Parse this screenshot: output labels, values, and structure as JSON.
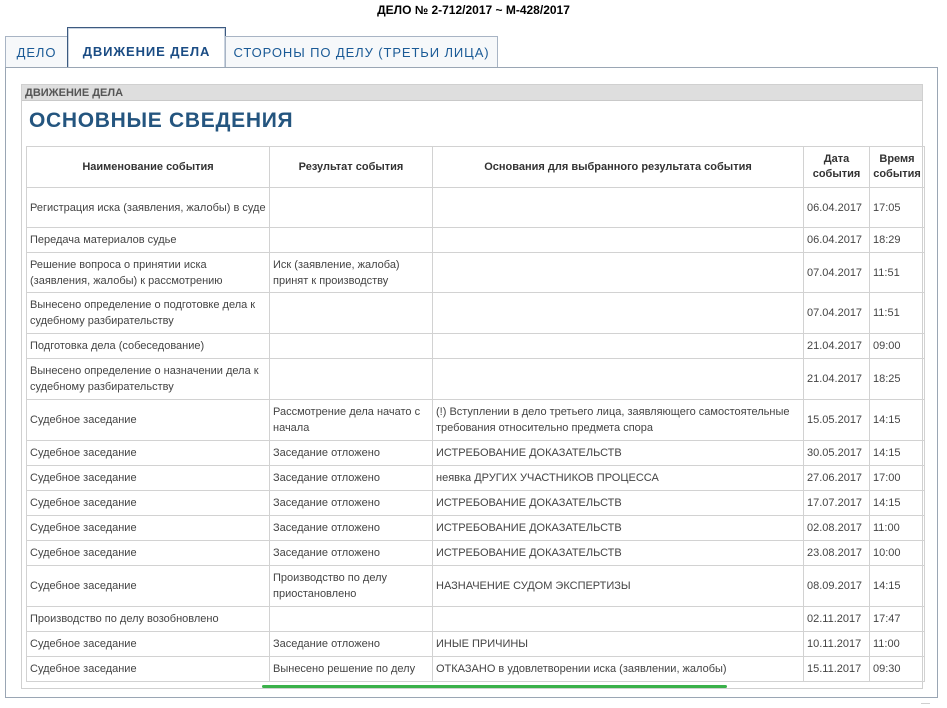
{
  "case_title": "ДЕЛО № 2-712/2017 ~ М-428/2017",
  "tabs": [
    {
      "label": "ДЕЛО"
    },
    {
      "label": "ДВИЖЕНИЕ ДЕЛА"
    },
    {
      "label": "СТОРОНЫ ПО ДЕЛУ (ТРЕТЬИ ЛИЦА)"
    }
  ],
  "section_label": "ДВИЖЕНИЕ ДЕЛА",
  "heading": "ОСНОВНЫЕ СВЕДЕНИЯ",
  "table": {
    "headers": [
      "Наименование события",
      "Результат события",
      "Основания для выбранного результата события",
      "Дата события",
      "Время события"
    ],
    "rows": [
      [
        "Регистрация иска (заявления, жалобы) в суде",
        "",
        "",
        "06.04.2017",
        "17:05"
      ],
      [
        "Передача материалов судье",
        "",
        "",
        "06.04.2017",
        "18:29"
      ],
      [
        "Решение вопроса о принятии иска (заявления, жалобы) к рассмотрению",
        "Иск (заявление, жалоба) принят к производству",
        "",
        "07.04.2017",
        "11:51"
      ],
      [
        "Вынесено определение о подготовке дела к судебному разбирательству",
        "",
        "",
        "07.04.2017",
        "11:51"
      ],
      [
        "Подготовка дела (собеседование)",
        "",
        "",
        "21.04.2017",
        "09:00"
      ],
      [
        "Вынесено определение о назначении дела к судебному разбирательству",
        "",
        "",
        "21.04.2017",
        "18:25"
      ],
      [
        "Судебное заседание",
        "Рассмотрение дела начато с начала",
        "(!) Вступлении в дело третьего лица, заявляющего самостоятельные требования относительно предмета спора",
        "15.05.2017",
        "14:15"
      ],
      [
        "Судебное заседание",
        "Заседание отложено",
        "ИСТРЕБОВАНИЕ ДОКАЗАТЕЛЬСТВ",
        "30.05.2017",
        "14:15"
      ],
      [
        "Судебное заседание",
        "Заседание отложено",
        "неявка ДРУГИХ УЧАСТНИКОВ ПРОЦЕССА",
        "27.06.2017",
        "17:00"
      ],
      [
        "Судебное заседание",
        "Заседание отложено",
        "ИСТРЕБОВАНИЕ ДОКАЗАТЕЛЬСТВ",
        "17.07.2017",
        "14:15"
      ],
      [
        "Судебное заседание",
        "Заседание отложено",
        "ИСТРЕБОВАНИЕ ДОКАЗАТЕЛЬСТВ",
        "02.08.2017",
        "11:00"
      ],
      [
        "Судебное заседание",
        "Заседание отложено",
        "ИСТРЕБОВАНИЕ ДОКАЗАТЕЛЬСТВ",
        "23.08.2017",
        "10:00"
      ],
      [
        "Судебное заседание",
        "Производство по делу приостановлено",
        "НАЗНАЧЕНИЕ СУДОМ ЭКСПЕРТИЗЫ",
        "08.09.2017",
        "14:15"
      ],
      [
        "Производство по делу возобновлено",
        "",
        "",
        "02.11.2017",
        "17:47"
      ],
      [
        "Судебное заседание",
        "Заседание отложено",
        "ИНЫЕ ПРИЧИНЫ",
        "10.11.2017",
        "11:00"
      ],
      [
        "Судебное заседание",
        "Вынесено решение по делу",
        "ОТКАЗАНО в удовлетворении иска (заявлении, жалобы)",
        "15.11.2017",
        "09:30"
      ]
    ]
  },
  "colors": {
    "accent": "#1a5a96",
    "heading": "#24557f",
    "highlight_underline": "#3ab14a"
  }
}
